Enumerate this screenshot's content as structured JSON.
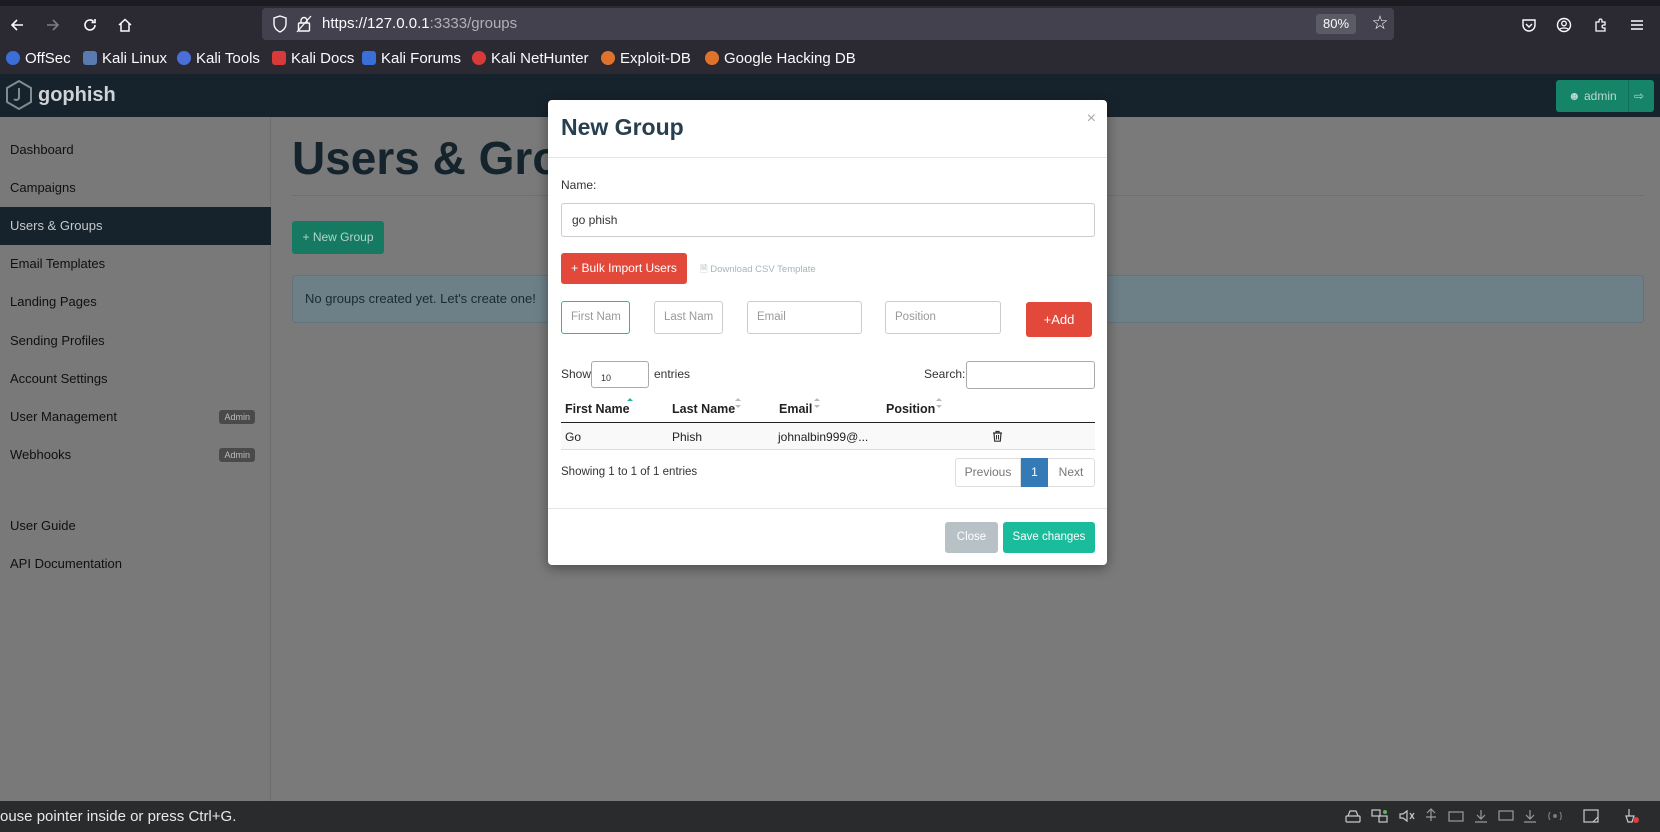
{
  "browser": {
    "url_host": "https://127.0.0.1",
    "url_path": ":3333/groups",
    "zoom": "80%",
    "bookmarks": [
      {
        "label": "OffSec",
        "color": "#3b6fd8"
      },
      {
        "label": "Kali Linux",
        "color": "#5a7bb0"
      },
      {
        "label": "Kali Tools",
        "color": "#4a6fd8"
      },
      {
        "label": "Kali Docs",
        "color": "#d83a3a"
      },
      {
        "label": "Kali Forums",
        "color": "#3b6fd8"
      },
      {
        "label": "Kali NetHunter",
        "color": "#d83a3a"
      },
      {
        "label": "Exploit-DB",
        "color": "#e0732c"
      },
      {
        "label": "Google Hacking DB",
        "color": "#e0732c"
      }
    ]
  },
  "app": {
    "logo": "gophish",
    "user": "admin"
  },
  "sidebar": {
    "items": [
      {
        "label": "Dashboard"
      },
      {
        "label": "Campaigns"
      },
      {
        "label": "Users & Groups",
        "active": true
      },
      {
        "label": "Email Templates"
      },
      {
        "label": "Landing Pages"
      },
      {
        "label": "Sending Profiles"
      },
      {
        "label": "Account Settings"
      },
      {
        "label": "User Management",
        "badge": "Admin"
      },
      {
        "label": "Webhooks",
        "badge": "Admin"
      },
      {
        "label": "User Guide"
      },
      {
        "label": "API Documentation"
      }
    ]
  },
  "main": {
    "title": "Users & Groups",
    "new_group_label": "New Group",
    "empty_alert": "No groups created yet. Let's create one!"
  },
  "modal": {
    "title": "New Group",
    "close_x": "×",
    "name_label": "Name:",
    "name_value": "go phish",
    "bulk_import_label": "Bulk Import Users",
    "csv_template_label": "Download CSV Template",
    "first_name_placeholder": "First Nam",
    "last_name_placeholder": "Last Nam",
    "email_placeholder": "Email",
    "position_placeholder": "Position",
    "add_label": "Add",
    "show_label": "Show",
    "show_value": "10",
    "entries_label": "entries",
    "search_label": "Search:",
    "columns": [
      "First Name",
      "Last Name",
      "Email",
      "Position"
    ],
    "rows": [
      {
        "first": "Go",
        "last": "Phish",
        "email": "johnalbin999@...",
        "position": ""
      }
    ],
    "showing_text": "Showing 1 to 1 of 1 entries",
    "pager": {
      "prev": "Previous",
      "current": "1",
      "next": "Next"
    },
    "close_label": "Close",
    "save_label": "Save changes"
  },
  "statusbar": {
    "text": "ouse pointer inside or press Ctrl+G."
  },
  "colors": {
    "accent": "#1abc9c",
    "danger": "#e2493b",
    "header": "#17232c",
    "pager_active": "#337ab7"
  }
}
